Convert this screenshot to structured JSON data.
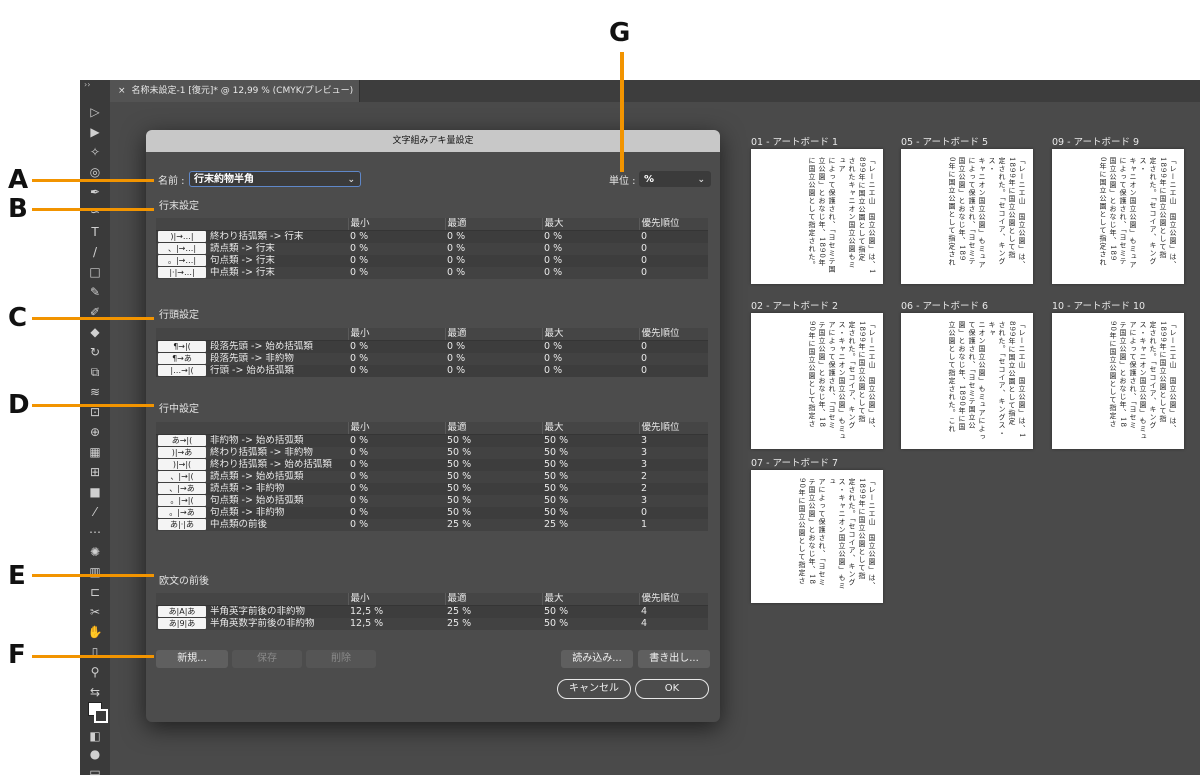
{
  "labels": [
    "A",
    "B",
    "C",
    "D",
    "E",
    "F",
    "G"
  ],
  "document": {
    "tab_title": "名称未設定-1 [復元]* @ 12,99 % (CMYK/プレビュー)",
    "close_glyph": "×"
  },
  "panel_toggle": "››",
  "dialog": {
    "title": "文字組みアキ量設定",
    "name_label": "名前 :",
    "name_value": "行末約物半角",
    "unit_label": "単位 :",
    "unit_value": "%",
    "columns": {
      "min": "最小",
      "opt": "最適",
      "max": "最大",
      "priority": "優先順位"
    },
    "sections": [
      {
        "title": "行末設定",
        "rows": [
          {
            "icon": ")|→…|",
            "label": "終わり括弧類 -> 行末",
            "min": "0 %",
            "opt": "0 %",
            "max": "0 %",
            "priority": "0"
          },
          {
            "icon": "、|→…|",
            "label": "読点類 -> 行末",
            "min": "0 %",
            "opt": "0 %",
            "max": "0 %",
            "priority": "0"
          },
          {
            "icon": "。|→…|",
            "label": "句点類 -> 行末",
            "min": "0 %",
            "opt": "0 %",
            "max": "0 %",
            "priority": "0"
          },
          {
            "icon": "|·|→…|",
            "label": "中点類 -> 行末",
            "min": "0 %",
            "opt": "0 %",
            "max": "0 %",
            "priority": "0"
          }
        ]
      },
      {
        "title": "行頭設定",
        "rows": [
          {
            "icon": "¶→|(",
            "label": "段落先頭 -> 始め括弧類",
            "min": "0 %",
            "opt": "0 %",
            "max": "0 %",
            "priority": "0"
          },
          {
            "icon": "¶→あ",
            "label": "段落先頭 -> 非約物",
            "min": "0 %",
            "opt": "0 %",
            "max": "0 %",
            "priority": "0"
          },
          {
            "icon": "|…→|(",
            "label": "行頭 -> 始め括弧類",
            "min": "0 %",
            "opt": "0 %",
            "max": "0 %",
            "priority": "0"
          }
        ]
      },
      {
        "title": "行中設定",
        "rows": [
          {
            "icon": "あ→|(",
            "label": "非約物 -> 始め括弧類",
            "min": "0 %",
            "opt": "50 %",
            "max": "50 %",
            "priority": "3"
          },
          {
            "icon": ")|→あ",
            "label": "終わり括弧類 -> 非約物",
            "min": "0 %",
            "opt": "50 %",
            "max": "50 %",
            "priority": "3"
          },
          {
            "icon": ")|→|(",
            "label": "終わり括弧類 -> 始め括弧類",
            "min": "0 %",
            "opt": "50 %",
            "max": "50 %",
            "priority": "3"
          },
          {
            "icon": "、|→|(",
            "label": "読点類 -> 始め括弧類",
            "min": "0 %",
            "opt": "50 %",
            "max": "50 %",
            "priority": "2"
          },
          {
            "icon": "、|→あ",
            "label": "読点類 -> 非約物",
            "min": "0 %",
            "opt": "50 %",
            "max": "50 %",
            "priority": "2"
          },
          {
            "icon": "。|→|(",
            "label": "句点類 -> 始め括弧類",
            "min": "0 %",
            "opt": "50 %",
            "max": "50 %",
            "priority": "3"
          },
          {
            "icon": "。|→あ",
            "label": "句点類 -> 非約物",
            "min": "0 %",
            "opt": "50 %",
            "max": "50 %",
            "priority": "0"
          },
          {
            "icon": "あ|·|あ",
            "label": "中点類の前後",
            "min": "0 %",
            "opt": "25 %",
            "max": "25 %",
            "priority": "1"
          }
        ]
      },
      {
        "title": "欧文の前後",
        "rows": [
          {
            "icon": "あ|A|あ",
            "label": "半角英字前後の非約物",
            "min": "12,5 %",
            "opt": "25 %",
            "max": "50 %",
            "priority": "4"
          },
          {
            "icon": "あ|9|あ",
            "label": "半角英数字前後の非約物",
            "min": "12,5 %",
            "opt": "25 %",
            "max": "50 %",
            "priority": "4"
          }
        ]
      }
    ],
    "buttons": {
      "new": "新規...",
      "save": "保存",
      "delete": "削除",
      "load": "読み込み...",
      "export": "書き出し...",
      "cancel": "キャンセル",
      "ok": "OK"
    }
  },
  "artboards": [
    {
      "title": "01 - アートボード 1",
      "lines": [
        "「レーニエ山　国立公園」は、1",
        "899年に国立公園として指定",
        "されたキャニオン国立公園もミュア",
        "によって保護され、「ヨセミテ国",
        "立公園」とおなじ年、1890年",
        "に国立公園として指定された。"
      ]
    },
    {
      "title": "05 - アートボード 5",
      "lines": [
        "「レーニエ山　国立公園」は、",
        "1899年に国立公園として指",
        "定された。「セコイア、キングス・",
        "キャニオン国立公園」もミュア",
        "によって保護され、「ヨセミテ",
        "国立公園」とおなじ年、189",
        "0年に国立公園として指定され"
      ]
    },
    {
      "title": "09 - アートボード 9",
      "lines": [
        "「レーニエ山　国立公園」は、",
        "1899年に国立公園として指",
        "定された。「セコイア、キングス・",
        "キャニオン国立公園」もミュア",
        "によって保護され、「ヨセミテ",
        "国立公園」とおなじ年、189",
        "0年に国立公園として指定され"
      ]
    },
    {
      "title": "02 - アートボード 2",
      "lines": [
        "「レーニエ山　国立公園」は、",
        "1899年に国立公園として指",
        "定された。「セコイア、キング",
        "ス・キャニオン国立公園」もミュ",
        "アによって保護され、「ヨセミ",
        "テ国立公園」とおなじ年、18",
        "90年に国立公園として指定さ"
      ]
    },
    {
      "title": "06 - アートボード 6",
      "lines": [
        "「レーニエ山　国立公園」は、1",
        "899年に国立公園として指定",
        "された。「セコイア、キングス・キャ",
        "ニオン国立公園」もミュアによっ",
        "て保護され、「ヨセミテ国立公",
        "園」とおなじ年、1890年に国",
        "立公園として指定された。これ"
      ]
    },
    {
      "title": "10 - アートボード 10",
      "lines": [
        "「レーニエ山　国立公園」は、",
        "1899年に国立公園として指",
        "定された。「セコイア、キング",
        "ス・キャニオン国立公園」もミュ",
        "アによって保護され、「ヨセミ",
        "テ国立公園」とおなじ年、18",
        "90年に国立公園として指定さ"
      ]
    },
    {
      "title": "07 - アートボード 7",
      "lines": [
        "「レーニエ山　国立公園」は、",
        "1899年に国立公園として指",
        "定された。「セコイア、キング",
        "ス・キャニオン国立公園」もミュ",
        "アによって保護され、「ヨセミ",
        "テ国立公園」とおなじ年、18",
        "90年に国立公園として指定さ"
      ]
    }
  ],
  "colors": {
    "accent_orange": "#f29400",
    "focus_blue": "#5f87c8"
  }
}
